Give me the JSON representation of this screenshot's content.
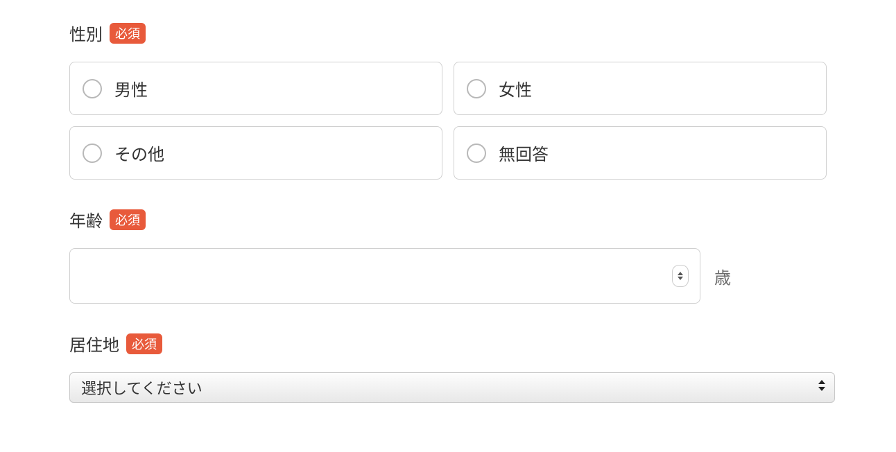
{
  "badges": {
    "required": "必須"
  },
  "gender": {
    "label": "性別",
    "options": [
      {
        "label": "男性"
      },
      {
        "label": "女性"
      },
      {
        "label": "その他"
      },
      {
        "label": "無回答"
      }
    ]
  },
  "age": {
    "label": "年齢",
    "value": "",
    "unit": "歳"
  },
  "residence": {
    "label": "居住地",
    "placeholder": "選択してください"
  }
}
